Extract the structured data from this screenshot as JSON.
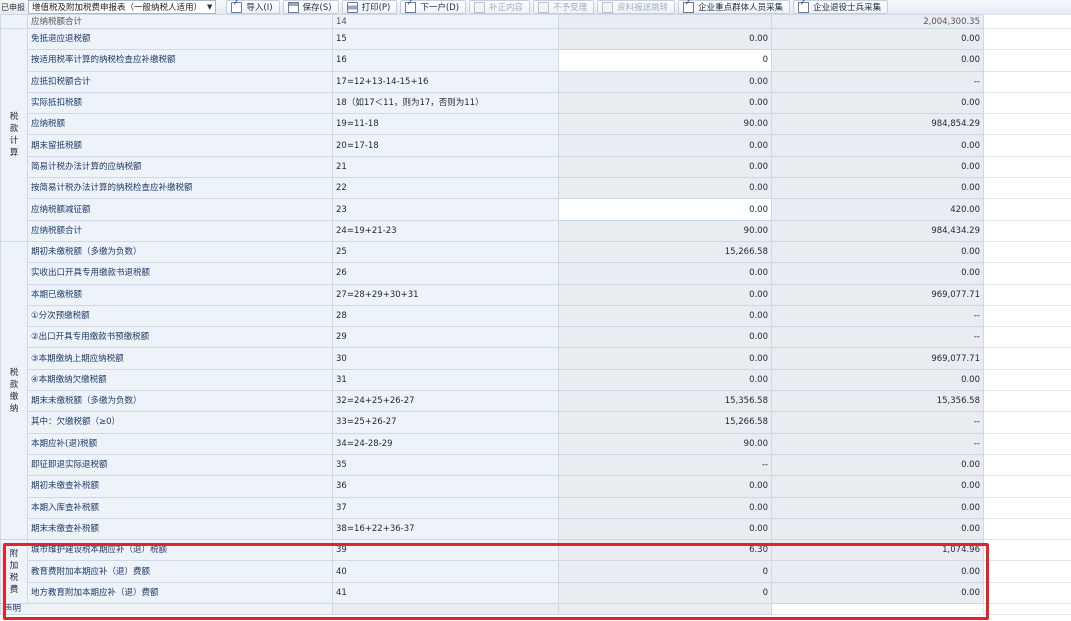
{
  "toolbar": {
    "left_cut_text": "已申报",
    "form_select": "增值税及附加税费申报表（一般纳税人适用）",
    "buttons": [
      {
        "label": "导入(I)",
        "icon": "import-icon",
        "enabled": true
      },
      {
        "label": "保存(S)",
        "icon": "save-icon",
        "enabled": true
      },
      {
        "label": "打印(P)",
        "icon": "print-icon",
        "enabled": true
      },
      {
        "label": "下一户(D)",
        "icon": "next-icon",
        "enabled": true
      },
      {
        "label": "补正内容",
        "icon": "edit-icon",
        "enabled": false
      },
      {
        "label": "不予受理",
        "icon": "edit-icon",
        "enabled": false
      },
      {
        "label": "资料报送跳转",
        "icon": "print-icon",
        "enabled": false
      },
      {
        "label": "企业重点群体人员采集",
        "icon": "document-icon",
        "enabled": true
      },
      {
        "label": "企业退役士兵采集",
        "icon": "document-icon",
        "enabled": true
      }
    ]
  },
  "table": {
    "partial_top_row": {
      "name": "应纳税额合计",
      "line": "14",
      "col1": "",
      "col2": "2,004,300.35"
    },
    "sections": {
      "tax_calc": "税款计算",
      "tax_pay": "税款缴纳",
      "surcharge": "附加税费"
    },
    "rows": [
      {
        "name": "免抵退应退税额",
        "formula": "15",
        "col1": "0.00",
        "col2": "0.00"
      },
      {
        "name": "按适用税率计算的纳税检查应补缴税额",
        "formula": "16",
        "col1": "0",
        "col2": "0.00"
      },
      {
        "name": "应抵扣税额合计",
        "formula": "17=12+13-14-15+16",
        "col1": "0.00",
        "col2": "--"
      },
      {
        "name": "实际抵扣税额",
        "formula": "18（如17＜11，则为17，否则为11）",
        "col1": "0.00",
        "col2": "0.00"
      },
      {
        "name": "应纳税额",
        "formula": "19=11-18",
        "col1": "90.00",
        "col2": "984,854.29"
      },
      {
        "name": "期末留抵税额",
        "formula": "20=17-18",
        "col1": "0.00",
        "col2": "0.00"
      },
      {
        "name": "简易计税办法计算的应纳税额",
        "formula": "21",
        "col1": "0.00",
        "col2": "0.00"
      },
      {
        "name": "按简易计税办法计算的纳税检查应补缴税额",
        "formula": "22",
        "col1": "0.00",
        "col2": "0.00"
      },
      {
        "name": "应纳税额减征额",
        "formula": "23",
        "col1": "0.00",
        "col2": "420.00"
      },
      {
        "name": "应纳税额合计",
        "formula": "24=19+21-23",
        "col1": "90.00",
        "col2": "984,434.29"
      },
      {
        "name": "期初未缴税额（多缴为负数）",
        "formula": "25",
        "col1": "15,266.58",
        "col2": "0.00"
      },
      {
        "name": "实收出口开具专用缴款书退税额",
        "formula": "26",
        "col1": "0.00",
        "col2": "0.00"
      },
      {
        "name": "本期已缴税额",
        "formula": "27=28+29+30+31",
        "col1": "0.00",
        "col2": "969,077.71"
      },
      {
        "name": "①分次预缴税额",
        "formula": "28",
        "col1": "0.00",
        "col2": "--"
      },
      {
        "name": "②出口开具专用缴款书预缴税额",
        "formula": "29",
        "col1": "0.00",
        "col2": "--"
      },
      {
        "name": "③本期缴纳上期应纳税额",
        "formula": "30",
        "col1": "0.00",
        "col2": "969,077.71"
      },
      {
        "name": "④本期缴纳欠缴税额",
        "formula": "31",
        "col1": "0.00",
        "col2": "0.00"
      },
      {
        "name": "期末未缴税额（多缴为负数）",
        "formula": "32=24+25+26-27",
        "col1": "15,356.58",
        "col2": "15,356.58"
      },
      {
        "name": "其中：欠缴税额（≥0）",
        "formula": "33=25+26-27",
        "col1": "15,266.58",
        "col2": "--"
      },
      {
        "name": "本期应补(退)税额",
        "formula": "34=24-28-29",
        "col1": "90.00",
        "col2": "--"
      },
      {
        "name": "即征即退实际退税额",
        "formula": "35",
        "col1": "--",
        "col2": "0.00"
      },
      {
        "name": "期初未缴查补税额",
        "formula": "36",
        "col1": "0.00",
        "col2": "0.00"
      },
      {
        "name": "本期入库查补税额",
        "formula": "37",
        "col1": "0.00",
        "col2": "0.00"
      },
      {
        "name": "期末未缴查补税额",
        "formula": "38=16+22+36-37",
        "col1": "0.00",
        "col2": "0.00"
      },
      {
        "name": "城市维护建设税本期应补（退）税额",
        "formula": "39",
        "col1": "6.30",
        "col2": "1,074.96"
      },
      {
        "name": "教育费附加本期应补（退）费额",
        "formula": "40",
        "col1": "0",
        "col2": "0.00"
      },
      {
        "name": "地方教育附加本期应补（退）费额",
        "formula": "41",
        "col1": "0",
        "col2": "0.00"
      }
    ],
    "bottom_cut_text": "声明"
  },
  "colors": {
    "highlight_border": "#e5212a",
    "header_bg": "#eef3fa",
    "readonly_cell_bg": "#e9ecf0"
  }
}
